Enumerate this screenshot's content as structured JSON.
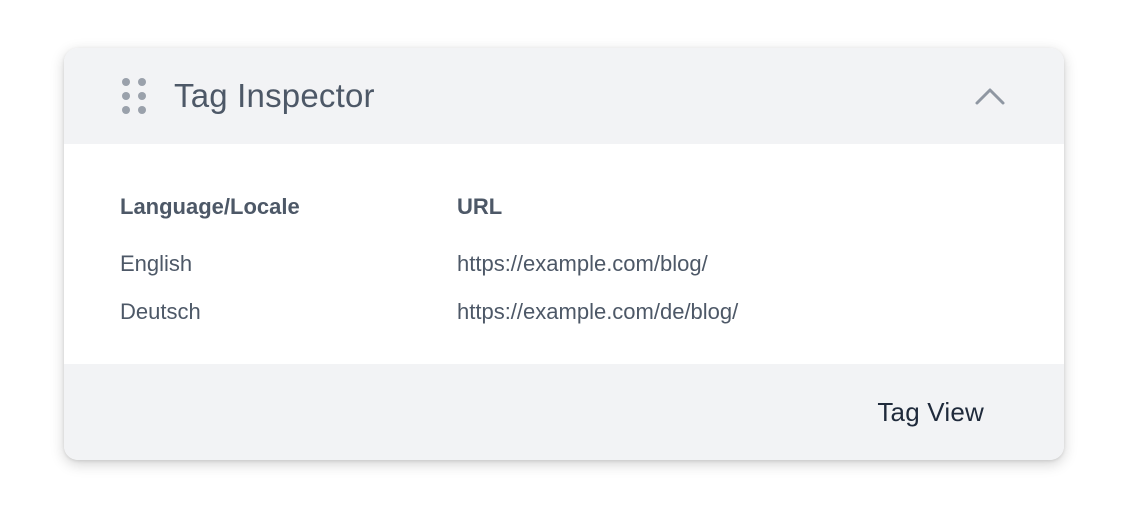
{
  "header": {
    "title": "Tag Inspector",
    "drag_icon": "drag-handle-icon",
    "collapse_icon": "chevron-up-icon"
  },
  "table": {
    "columns": [
      "Language/Locale",
      "URL"
    ],
    "rows": [
      [
        "English",
        "https://example.com/blog/"
      ],
      [
        "Deutsch",
        "https://example.com/de/blog/"
      ]
    ]
  },
  "footer": {
    "action_label": "Tag View"
  },
  "colors": {
    "panel_bg": "#f2f3f5",
    "text": "#4d5867",
    "button_text": "#1f2a3b",
    "icon": "#9aa1ab"
  }
}
